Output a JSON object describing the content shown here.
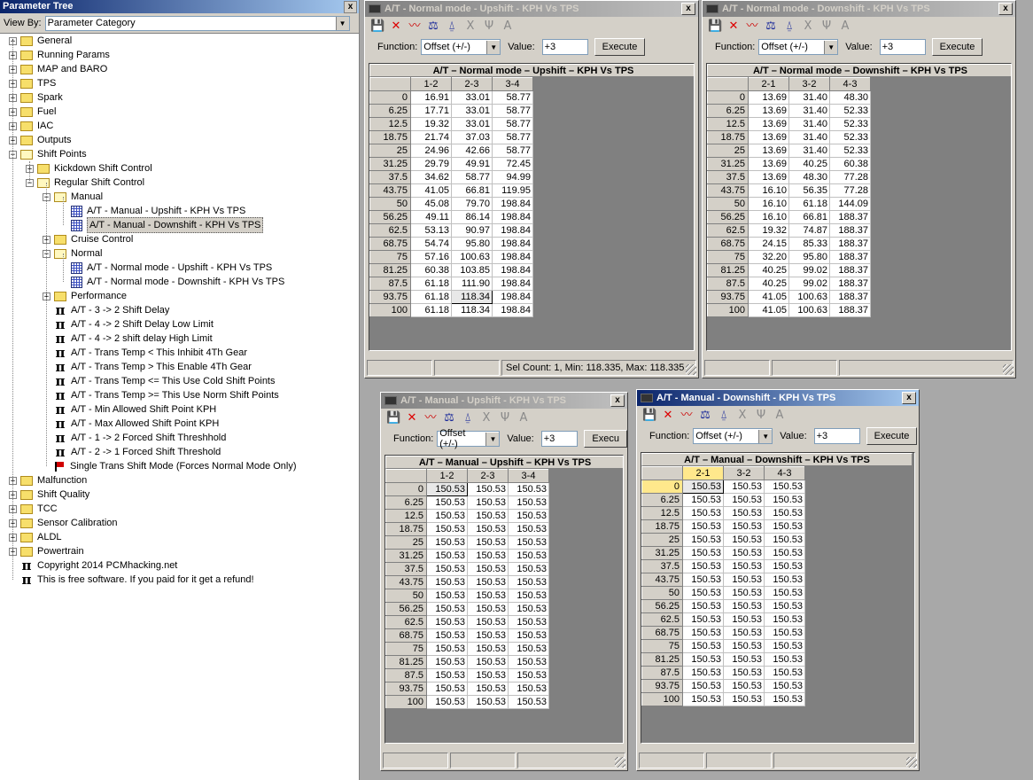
{
  "tree_pane": {
    "title": "Parameter Tree",
    "close": "x",
    "view_by_label": "View By:",
    "view_by_value": "Parameter Category",
    "items": [
      {
        "text": "General",
        "level": 0,
        "icon": "folder",
        "exp": "+"
      },
      {
        "text": "Running Params",
        "level": 0,
        "icon": "folder",
        "exp": "+"
      },
      {
        "text": "MAP and BARO",
        "level": 0,
        "icon": "folder",
        "exp": "+"
      },
      {
        "text": "TPS",
        "level": 0,
        "icon": "folder",
        "exp": "+"
      },
      {
        "text": "Spark",
        "level": 0,
        "icon": "folder",
        "exp": "+"
      },
      {
        "text": "Fuel",
        "level": 0,
        "icon": "folder",
        "exp": "+"
      },
      {
        "text": "IAC",
        "level": 0,
        "icon": "folder",
        "exp": "+"
      },
      {
        "text": "Outputs",
        "level": 0,
        "icon": "folder",
        "exp": "+"
      },
      {
        "text": "Shift Points",
        "level": 0,
        "icon": "folder-open",
        "exp": "-"
      },
      {
        "text": "Kickdown Shift Control",
        "level": 1,
        "icon": "folder",
        "exp": "+"
      },
      {
        "text": "Regular Shift Control",
        "level": 1,
        "icon": "folder-open",
        "exp": "-"
      },
      {
        "text": "Manual",
        "level": 2,
        "icon": "folder-open",
        "exp": "-"
      },
      {
        "text": "A/T - Manual - Upshift - KPH Vs TPS",
        "level": 3,
        "icon": "grid",
        "exp": ""
      },
      {
        "text": "A/T - Manual - Downshift - KPH Vs TPS",
        "level": 3,
        "icon": "grid",
        "exp": "",
        "selected": true
      },
      {
        "text": "Cruise Control",
        "level": 2,
        "icon": "folder",
        "exp": "+"
      },
      {
        "text": "Normal",
        "level": 2,
        "icon": "folder-open",
        "exp": "-"
      },
      {
        "text": "A/T - Normal mode - Upshift - KPH Vs TPS",
        "level": 3,
        "icon": "grid",
        "exp": ""
      },
      {
        "text": "A/T - Normal mode - Downshift - KPH Vs TPS",
        "level": 3,
        "icon": "grid",
        "exp": ""
      },
      {
        "text": "Performance",
        "level": 2,
        "icon": "folder",
        "exp": "+"
      },
      {
        "text": "A/T - 3 -> 2 Shift Delay",
        "level": 2,
        "icon": "pi",
        "exp": ""
      },
      {
        "text": "A/T - 4 -> 2 Shift Delay Low Limit",
        "level": 2,
        "icon": "pi",
        "exp": ""
      },
      {
        "text": "A/T - 4 -> 2 shift delay High Limit",
        "level": 2,
        "icon": "pi",
        "exp": ""
      },
      {
        "text": "A/T - Trans Temp < This Inhibit 4Th Gear",
        "level": 2,
        "icon": "pi",
        "exp": ""
      },
      {
        "text": "A/T - Trans Temp > This Enable 4Th Gear",
        "level": 2,
        "icon": "pi",
        "exp": ""
      },
      {
        "text": "A/T - Trans Temp <= This Use Cold Shift Points",
        "level": 2,
        "icon": "pi",
        "exp": ""
      },
      {
        "text": "A/T - Trans Temp >= This Use Norm Shift Points",
        "level": 2,
        "icon": "pi",
        "exp": ""
      },
      {
        "text": "A/T - Min Allowed Shift Point KPH",
        "level": 2,
        "icon": "pi",
        "exp": ""
      },
      {
        "text": "A/T - Max Allowed Shift Point KPH",
        "level": 2,
        "icon": "pi",
        "exp": ""
      },
      {
        "text": "A/T - 1 -> 2 Forced Shift Threshhold",
        "level": 2,
        "icon": "pi",
        "exp": ""
      },
      {
        "text": "A/T - 2 -> 1 Forced Shift Threshold",
        "level": 2,
        "icon": "pi",
        "exp": ""
      },
      {
        "text": "Single Trans Shift Mode (Forces Normal Mode Only)",
        "level": 2,
        "icon": "flag",
        "exp": ""
      },
      {
        "text": "Malfunction",
        "level": 0,
        "icon": "folder",
        "exp": "+"
      },
      {
        "text": "Shift Quality",
        "level": 0,
        "icon": "folder",
        "exp": "+"
      },
      {
        "text": "TCC",
        "level": 0,
        "icon": "folder",
        "exp": "+"
      },
      {
        "text": "Sensor Calibration",
        "level": 0,
        "icon": "folder",
        "exp": "+"
      },
      {
        "text": "ALDL",
        "level": 0,
        "icon": "folder",
        "exp": "+"
      },
      {
        "text": "Powertrain",
        "level": 0,
        "icon": "folder",
        "exp": "+"
      },
      {
        "text": "Copyright 2014 PCMhacking.net",
        "level": 0,
        "icon": "pi",
        "exp": ""
      },
      {
        "text": "This is free software. If you paid for it get a refund!",
        "level": 0,
        "icon": "pi",
        "exp": ""
      }
    ]
  },
  "common": {
    "function_label": "Function:",
    "function_value": "Offset (+/-)",
    "value_label": "Value:",
    "value": "+3",
    "execute": "Execute",
    "close": "x",
    "rows": [
      "0",
      "6.25",
      "12.5",
      "18.75",
      "25",
      "31.25",
      "37.5",
      "43.75",
      "50",
      "56.25",
      "62.5",
      "68.75",
      "75",
      "81.25",
      "87.5",
      "93.75",
      "100"
    ]
  },
  "windows": [
    {
      "id": "normal-up",
      "title": "A/T - Normal mode - Upshift - KPH Vs TPS",
      "table_title": "A/T – Normal mode – Upshift – KPH Vs TPS",
      "cols": [
        "1-2",
        "2-3",
        "3-4"
      ],
      "data": [
        [
          "16.91",
          "33.01",
          "58.77"
        ],
        [
          "17.71",
          "33.01",
          "58.77"
        ],
        [
          "19.32",
          "33.01",
          "58.77"
        ],
        [
          "21.74",
          "37.03",
          "58.77"
        ],
        [
          "24.96",
          "42.66",
          "58.77"
        ],
        [
          "29.79",
          "49.91",
          "72.45"
        ],
        [
          "34.62",
          "58.77",
          "94.99"
        ],
        [
          "41.05",
          "66.81",
          "119.95"
        ],
        [
          "45.08",
          "79.70",
          "198.84"
        ],
        [
          "49.11",
          "86.14",
          "198.84"
        ],
        [
          "53.13",
          "90.97",
          "198.84"
        ],
        [
          "54.74",
          "95.80",
          "198.84"
        ],
        [
          "57.16",
          "100.63",
          "198.84"
        ],
        [
          "60.38",
          "103.85",
          "198.84"
        ],
        [
          "61.18",
          "111.90",
          "198.84"
        ],
        [
          "61.18",
          "118.34",
          "198.84"
        ],
        [
          "61.18",
          "118.34",
          "198.84"
        ]
      ],
      "status": [
        "",
        "",
        "Sel Count: 1, Min: 118.335, Max: 118.335"
      ]
    },
    {
      "id": "normal-down",
      "title": "A/T - Normal mode - Downshift - KPH Vs TPS",
      "table_title": "A/T – Normal mode – Downshift – KPH Vs TPS",
      "cols": [
        "2-1",
        "3-2",
        "4-3"
      ],
      "data": [
        [
          "13.69",
          "31.40",
          "48.30"
        ],
        [
          "13.69",
          "31.40",
          "52.33"
        ],
        [
          "13.69",
          "31.40",
          "52.33"
        ],
        [
          "13.69",
          "31.40",
          "52.33"
        ],
        [
          "13.69",
          "31.40",
          "52.33"
        ],
        [
          "13.69",
          "40.25",
          "60.38"
        ],
        [
          "13.69",
          "48.30",
          "77.28"
        ],
        [
          "16.10",
          "56.35",
          "77.28"
        ],
        [
          "16.10",
          "61.18",
          "144.09"
        ],
        [
          "16.10",
          "66.81",
          "188.37"
        ],
        [
          "19.32",
          "74.87",
          "188.37"
        ],
        [
          "24.15",
          "85.33",
          "188.37"
        ],
        [
          "32.20",
          "95.80",
          "188.37"
        ],
        [
          "40.25",
          "99.02",
          "188.37"
        ],
        [
          "40.25",
          "99.02",
          "188.37"
        ],
        [
          "41.05",
          "100.63",
          "188.37"
        ],
        [
          "41.05",
          "100.63",
          "188.37"
        ]
      ],
      "status": [
        "",
        "",
        ""
      ]
    },
    {
      "id": "manual-up",
      "title": "A/T - Manual - Upshift - KPH Vs TPS",
      "table_title": "A/T – Manual – Upshift – KPH Vs TPS",
      "execute_short": "Execu",
      "cols": [
        "1-2",
        "2-3",
        "3-4"
      ],
      "data": "150.53",
      "status": [
        "",
        "",
        ""
      ]
    },
    {
      "id": "manual-down",
      "title": "A/T - Manual - Downshift - KPH Vs TPS",
      "table_title": "A/T – Manual – Downshift – KPH Vs TPS",
      "cols": [
        "2-1",
        "3-2",
        "4-3"
      ],
      "data": "150.53",
      "status": [
        "",
        "",
        ""
      ]
    }
  ],
  "toolbar_icons": [
    "save-icon",
    "delete-icon",
    "graph-icon",
    "scale-icon",
    "trace-icon",
    "clear-icon",
    "split-icon",
    "font-icon"
  ],
  "colors": {
    "active_title": "#0a246a",
    "inactive_title": "#808080",
    "highlight_header": "#ffe88c"
  }
}
